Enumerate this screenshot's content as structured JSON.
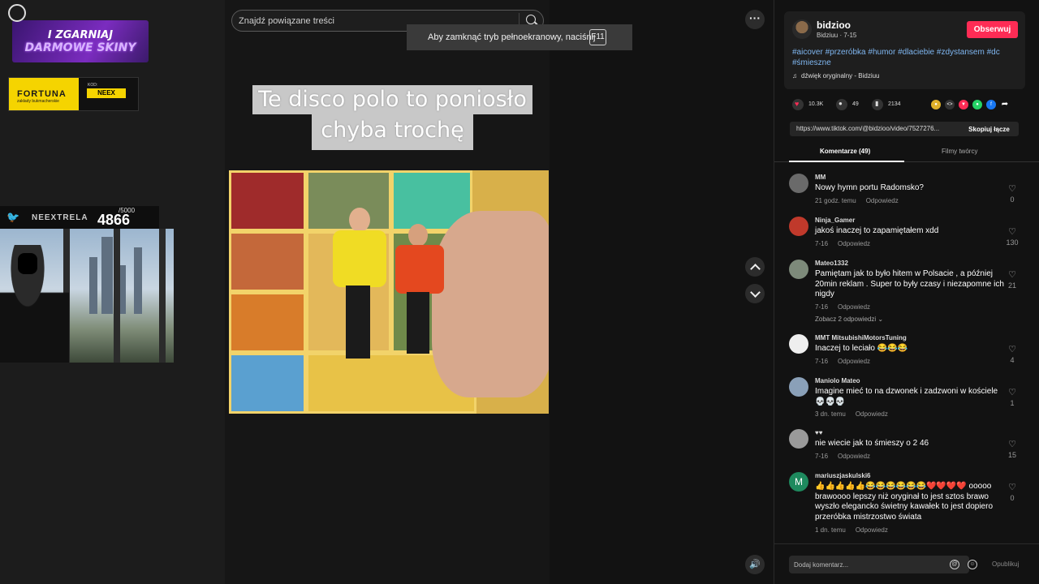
{
  "overlays": {
    "promo_top_line1": "I ZGARNIAJ",
    "promo_top_line2": "DARMOWE SKINY",
    "fortuna_brand": "FORTUNA",
    "fortuna_tagline": "zakłady bukmacherskie",
    "fortuna_kod_label": "KOD:",
    "fortuna_code": "NEEX",
    "counter_name": "NEEXTRELA",
    "counter_value": "4866",
    "counter_max": "/5000"
  },
  "search": {
    "placeholder": "Znajdź powiązane treści"
  },
  "fullscreen_tip": {
    "message": "Aby zamknąć tryb pełnoekranowy, naciśnij",
    "key": "F11"
  },
  "video": {
    "caption_line1": "Te disco polo to poniosło",
    "caption_line2": "chyba trochę"
  },
  "icons": {
    "more": "more-icon",
    "up": "chevron-up-icon",
    "down": "chevron-down-icon",
    "volume": "volume-icon"
  },
  "post": {
    "author": "bidzioo",
    "subtitle": "Bidziuu · 7-15",
    "follow_label": "Obserwuj",
    "hashtags": "#aicover #przeróbka #humor #dlaciebie #zdystansem #dc #śmieszne",
    "sound": "dźwięk oryginalny - Bidziuu",
    "likes": "10.3K",
    "comments": "49",
    "saves": "2134",
    "link": "https://www.tiktok.com/@bidzioo/video/7527276...",
    "copy_label": "Skopiuj łącze"
  },
  "tabs": [
    {
      "label": "Komentarze (49)"
    },
    {
      "label": "Filmy twórcy"
    }
  ],
  "comments": [
    {
      "user": "MM",
      "text": "Nowy hymn portu Radomsko?",
      "time": "21 godz. temu",
      "reply": "Odpowiedz",
      "likes": "0",
      "avatar": ""
    },
    {
      "user": "Ninja_Gamer",
      "text": "jakoś inaczej to zapamiętałem xdd",
      "time": "7-16",
      "reply": "Odpowiedz",
      "likes": "130",
      "avatar": ""
    },
    {
      "user": "Mateo1332",
      "text": "Pamiętam jak to było hitem w Polsacie , a później 20min reklam . Super to były czasy i niezapomne ich nigdy",
      "time": "7-16",
      "reply": "Odpowiedz",
      "likes": "21",
      "avatar": "",
      "replies": "Zobacz 2 odpowiedzi"
    },
    {
      "user": "MMT MitsubishiMotorsTuning",
      "text": "Inaczej to leciało 😂😂😂",
      "time": "7-16",
      "reply": "Odpowiedz",
      "likes": "4",
      "avatar": ""
    },
    {
      "user": "Maniolo Mateo",
      "text": "Imagine mieć to na dzwonek i zadzwoni w kościele 💀💀💀",
      "time": "3 dn. temu",
      "reply": "Odpowiedz",
      "likes": "1",
      "avatar": ""
    },
    {
      "user": "♥♥",
      "text": "nie wiecie jak to śmieszy o 2 46",
      "time": "7-16",
      "reply": "Odpowiedz",
      "likes": "15",
      "avatar": ""
    },
    {
      "user": "mariuszjaskulski6",
      "text": "👍👍👍👍👍😂😂😂😂😂😂❤️❤️❤️❤️ ooooo brawoooo lepszy niż oryginał to jest sztos brawo wyszło elegancko świetny kawałek to jest dopiero przeróbka mistrzostwo świata",
      "time": "1 dn. temu",
      "reply": "Odpowiedz",
      "likes": "0",
      "avatar": "M"
    }
  ],
  "composer": {
    "placeholder": "Dodaj komentarz...",
    "post_label": "Opublikuj"
  },
  "colors": {
    "follow": "#fe2c55",
    "hashtag": "#7fb6f0",
    "fortuna": "#f5d400"
  }
}
